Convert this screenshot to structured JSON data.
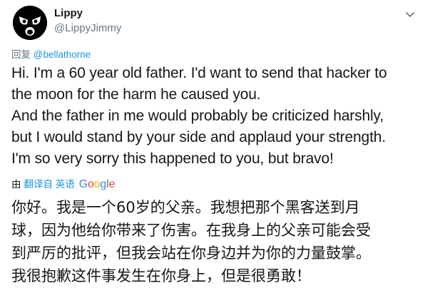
{
  "user": {
    "display_name": "Lippy",
    "handle": "@LippyJimmy"
  },
  "reply": {
    "prefix": "回复",
    "mention": "@bellathorne"
  },
  "tweet_text": "Hi. I'm a 60 year old father. I'd want to send that hacker to\nthe moon for the harm he caused you.\nAnd the father in me would probably be criticized harshly,\nbut I would stand by your side and applaud your strength.\nI'm so very sorry this happened to you, but bravo!",
  "translation": {
    "by": "由",
    "translated_from": "翻译自 英语",
    "google": [
      "G",
      "o",
      "o",
      "g",
      "l",
      "e"
    ],
    "google_colors": [
      "#4285f4",
      "#ea4335",
      "#fbbc05",
      "#4285f4",
      "#34a853",
      "#ea4335"
    ],
    "text": "你好。我是一个60岁的父亲。我想把那个黑客送到月\n球，因为他给你带来了伤害。在我身上的父亲可能会受\n到严厉的批评，但我会站在你身边并为你的力量鼓掌。\n我很抱歉这件事发生在你身上，但是很勇敢！"
  },
  "icons": {
    "avatar": "angry-face-avatar",
    "caret": "chevron-down-icon"
  },
  "colors": {
    "link": "#1b95e0",
    "secondary": "#657786",
    "text": "#14171a"
  }
}
